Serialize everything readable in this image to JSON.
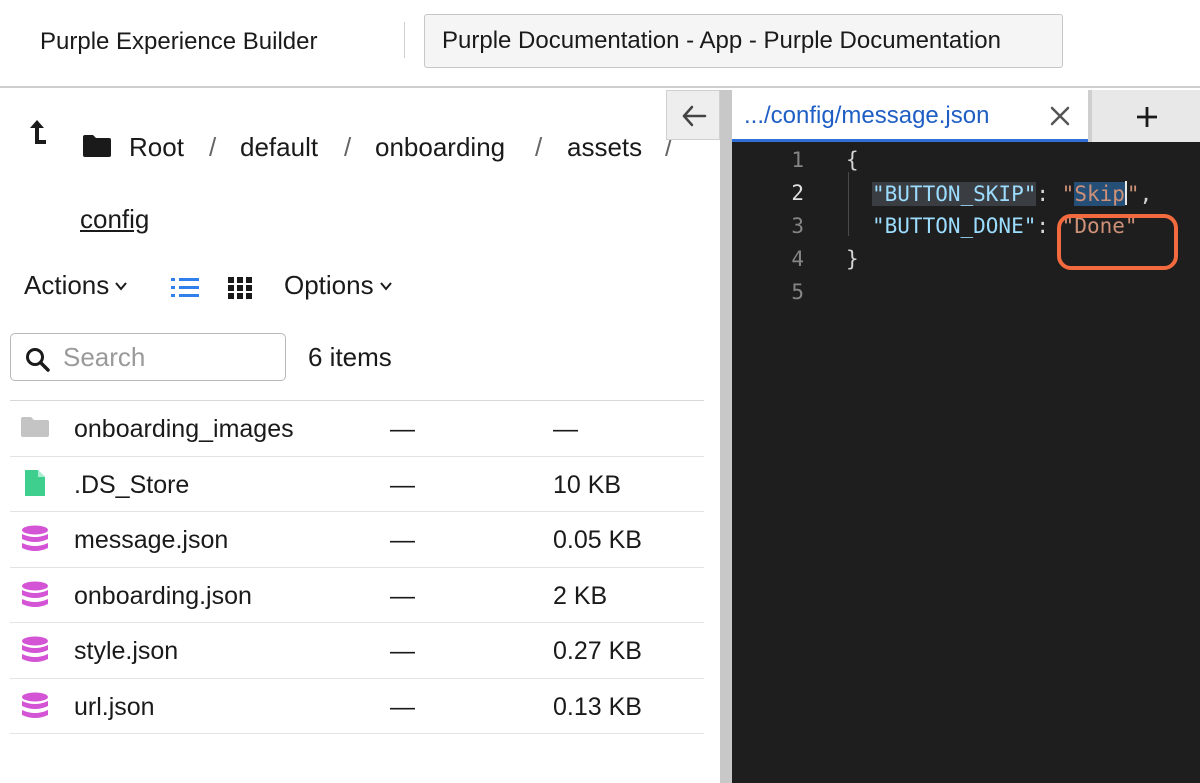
{
  "header": {
    "app_title": "Purple Experience Builder",
    "project_label": "Purple Documentation - App - Purple Documentation"
  },
  "breadcrumb": {
    "items": [
      "Root",
      "default",
      "onboarding",
      "assets"
    ],
    "separator": "/",
    "current": "config"
  },
  "toolbar": {
    "actions_label": "Actions",
    "options_label": "Options",
    "list_view_active": true
  },
  "search": {
    "placeholder": "Search",
    "value": ""
  },
  "item_count": "6 items",
  "files": [
    {
      "name": "onboarding_images",
      "modified": "—",
      "size": "—",
      "icon": "folder-icon",
      "color": "#c4c4c4"
    },
    {
      "name": ".DS_Store",
      "modified": "—",
      "size": "10 KB",
      "icon": "file-icon",
      "color": "#3ecf8e"
    },
    {
      "name": "message.json",
      "modified": "—",
      "size": "0.05 KB",
      "icon": "database-icon",
      "color": "#d454d6"
    },
    {
      "name": "onboarding.json",
      "modified": "—",
      "size": "2 KB",
      "icon": "database-icon",
      "color": "#d454d6"
    },
    {
      "name": "style.json",
      "modified": "—",
      "size": "0.27 KB",
      "icon": "database-icon",
      "color": "#d454d6"
    },
    {
      "name": "url.json",
      "modified": "—",
      "size": "0.13 KB",
      "icon": "database-icon",
      "color": "#d454d6"
    }
  ],
  "editor": {
    "tab_label": ".../config/message.json",
    "line_numbers": [
      "1",
      "2",
      "3",
      "4",
      "5"
    ],
    "current_line": 2,
    "lines": {
      "l1": "{",
      "l2_key": "\"BUTTON_SKIP\"",
      "l2_colon": ": ",
      "l2_q1": "\"",
      "l2_sel": "Skip",
      "l2_q2": "\"",
      "l2_comma": ",",
      "l3_key": "\"BUTTON_DONE\"",
      "l3_colon": ": ",
      "l3_val": "\"Done\"",
      "l4": "}"
    }
  },
  "colors": {
    "accent_blue": "#2f6fd6",
    "highlight_ring": "#f26a3d",
    "editor_bg": "#1e1e1e"
  }
}
